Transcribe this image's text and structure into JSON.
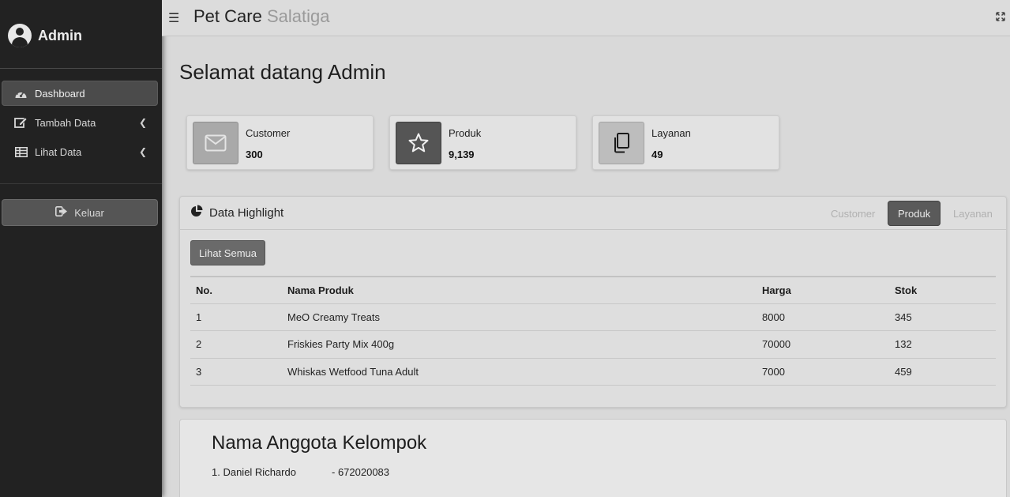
{
  "sidebar": {
    "brand": "Admin",
    "items": [
      {
        "label": "Dashboard",
        "icon": "gauge-icon",
        "active": true
      },
      {
        "label": "Tambah Data",
        "icon": "edit-icon",
        "active": false
      },
      {
        "label": "Lihat Data",
        "icon": "table-icon",
        "active": false
      }
    ],
    "logout_label": "Keluar"
  },
  "topbar": {
    "title_part1": "Pet Care",
    "title_part2": "Salatiga"
  },
  "welcome": "Selamat datang Admin",
  "info_boxes": [
    {
      "label": "Customer",
      "value": "300",
      "icon": "envelope-icon"
    },
    {
      "label": "Produk",
      "value": "9,139",
      "icon": "star-icon"
    },
    {
      "label": "Layanan",
      "value": "49",
      "icon": "copy-icon"
    }
  ],
  "highlight": {
    "title": "Data Highlight",
    "tabs": [
      "Customer",
      "Produk",
      "Layanan"
    ],
    "active_tab": "Produk",
    "view_all_label": "Lihat Semua",
    "columns": [
      "No.",
      "Nama Produk",
      "Harga",
      "Stok"
    ],
    "rows": [
      [
        "1",
        "MeO Creamy Treats",
        "8000",
        "345"
      ],
      [
        "2",
        "Friskies Party Mix 400g",
        "70000",
        "132"
      ],
      [
        "3",
        "Whiskas Wetfood Tuna Adult",
        "7000",
        "459"
      ]
    ]
  },
  "members": {
    "title": "Nama Anggota Kelompok",
    "list": [
      {
        "name": "1. Daniel Richardo",
        "nim": "- 672020083"
      }
    ]
  },
  "colors": {
    "sidebar_bg": "#222222",
    "active_tab_bg": "#5a5a5a",
    "page_bg": "#d9d9d9"
  }
}
